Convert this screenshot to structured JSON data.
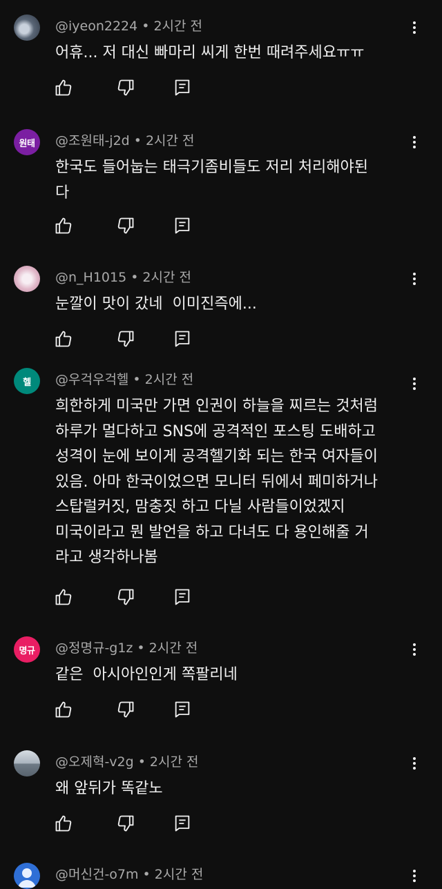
{
  "comments": [
    {
      "handle": "@iyeon2224",
      "time": "2시간 전",
      "avatar_text": "",
      "avatar_color": "#6b7585",
      "text": "어휴... 저 대신 빠마리 씨게 한번 때려주세요ㅠㅠ"
    },
    {
      "handle": "@조원태-j2d",
      "time": "2시간 전",
      "avatar_text": "원태",
      "avatar_color": "#7b1fa2",
      "text": "한국도 들어눕는 태극기좀비들도 저리 처리해야된\n다"
    },
    {
      "handle": "@n_H1015",
      "time": "2시간 전",
      "avatar_text": "",
      "avatar_color": "#e1b8c9",
      "text": "눈깔이 맛이 갔네  이미진즉에..."
    },
    {
      "handle": "@우걱우걱헬",
      "time": "2시간 전",
      "avatar_text": "헬",
      "avatar_color": "#00897b",
      "text": "희한하게 미국만 가면 인권이 하늘을 찌르는 것처럼\n하루가 멀다하고 SNS에 공격적인 포스팅 도배하고\n성격이 눈에 보이게 공격헬기화 되는 한국 여자들이\n있음. 아마 한국이었으면 모니터 뒤에서 페미하거나\n스탑럴커짓, 맘충짓 하고 다닐 사람들이었겠지\n미국이라고 뭔 발언을 하고 다녀도 다 용인해줄 거\n라고 생각하나봄"
    },
    {
      "handle": "@정명규-g1z",
      "time": "2시간 전",
      "avatar_text": "명규",
      "avatar_color": "#e91e63",
      "text": "같은  아시아인인게 쪽팔리네"
    },
    {
      "handle": "@오제혁-v2g",
      "time": "2시간 전",
      "avatar_text": "",
      "avatar_color": "#8e9aa6",
      "text": "왜 앞뒤가 똑같노"
    },
    {
      "handle": "@머신건-o7m",
      "time": "2시간 전",
      "avatar_text": "",
      "avatar_color": "#2f6fd6",
      "text": ""
    }
  ]
}
